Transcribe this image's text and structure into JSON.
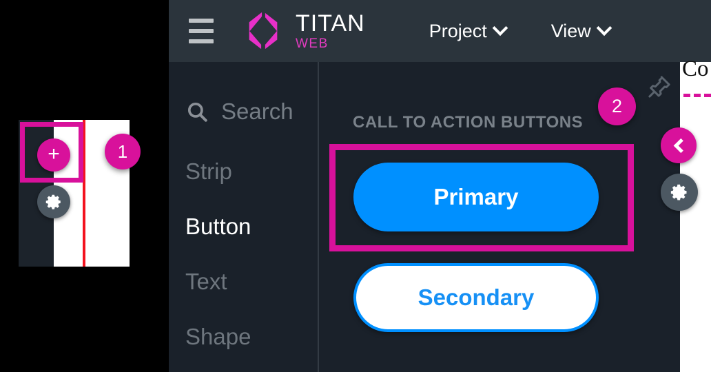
{
  "header": {
    "menu_icon": "hamburger-menu-icon",
    "logo_icon": "titan-hexagon-logo",
    "brand_title": "TITAN",
    "brand_subtitle": "WEB",
    "nav": [
      {
        "label": "Project",
        "icon": "chevron-down-icon"
      },
      {
        "label": "View",
        "icon": "chevron-down-icon"
      }
    ]
  },
  "sidebar": {
    "search": {
      "icon": "search-icon",
      "placeholder": "Search",
      "value": ""
    },
    "items": [
      {
        "label": "Strip",
        "active": false
      },
      {
        "label": "Button",
        "active": true
      },
      {
        "label": "Text",
        "active": false
      },
      {
        "label": "Shape",
        "active": false
      }
    ]
  },
  "canvas": {
    "section_title": "CALL TO ACTION BUTTONS",
    "buttons": [
      {
        "label": "Primary",
        "style": "filled",
        "highlighted": true
      },
      {
        "label": "Secondary",
        "style": "outline",
        "highlighted": false
      }
    ]
  },
  "annotations": [
    {
      "number": "1",
      "target": "add-component-button"
    },
    {
      "number": "2",
      "target": "primary-button-group"
    }
  ],
  "left_preview": {
    "add_icon": "plus-icon",
    "settings_icon": "gear-icon"
  },
  "right_rail": {
    "pin_icon": "pin-icon",
    "collapse_icon": "chevron-left-icon",
    "settings_icon": "gear-icon",
    "clipped_title": "Co"
  },
  "colors": {
    "accent_magenta": "#D8119B",
    "primary_blue": "#0090FF",
    "header_bg": "#2B343C",
    "panel_bg": "#1A212A",
    "muted_text": "#6E767E",
    "gear_gray": "#4C5862",
    "red_guide": "#F3131F"
  }
}
